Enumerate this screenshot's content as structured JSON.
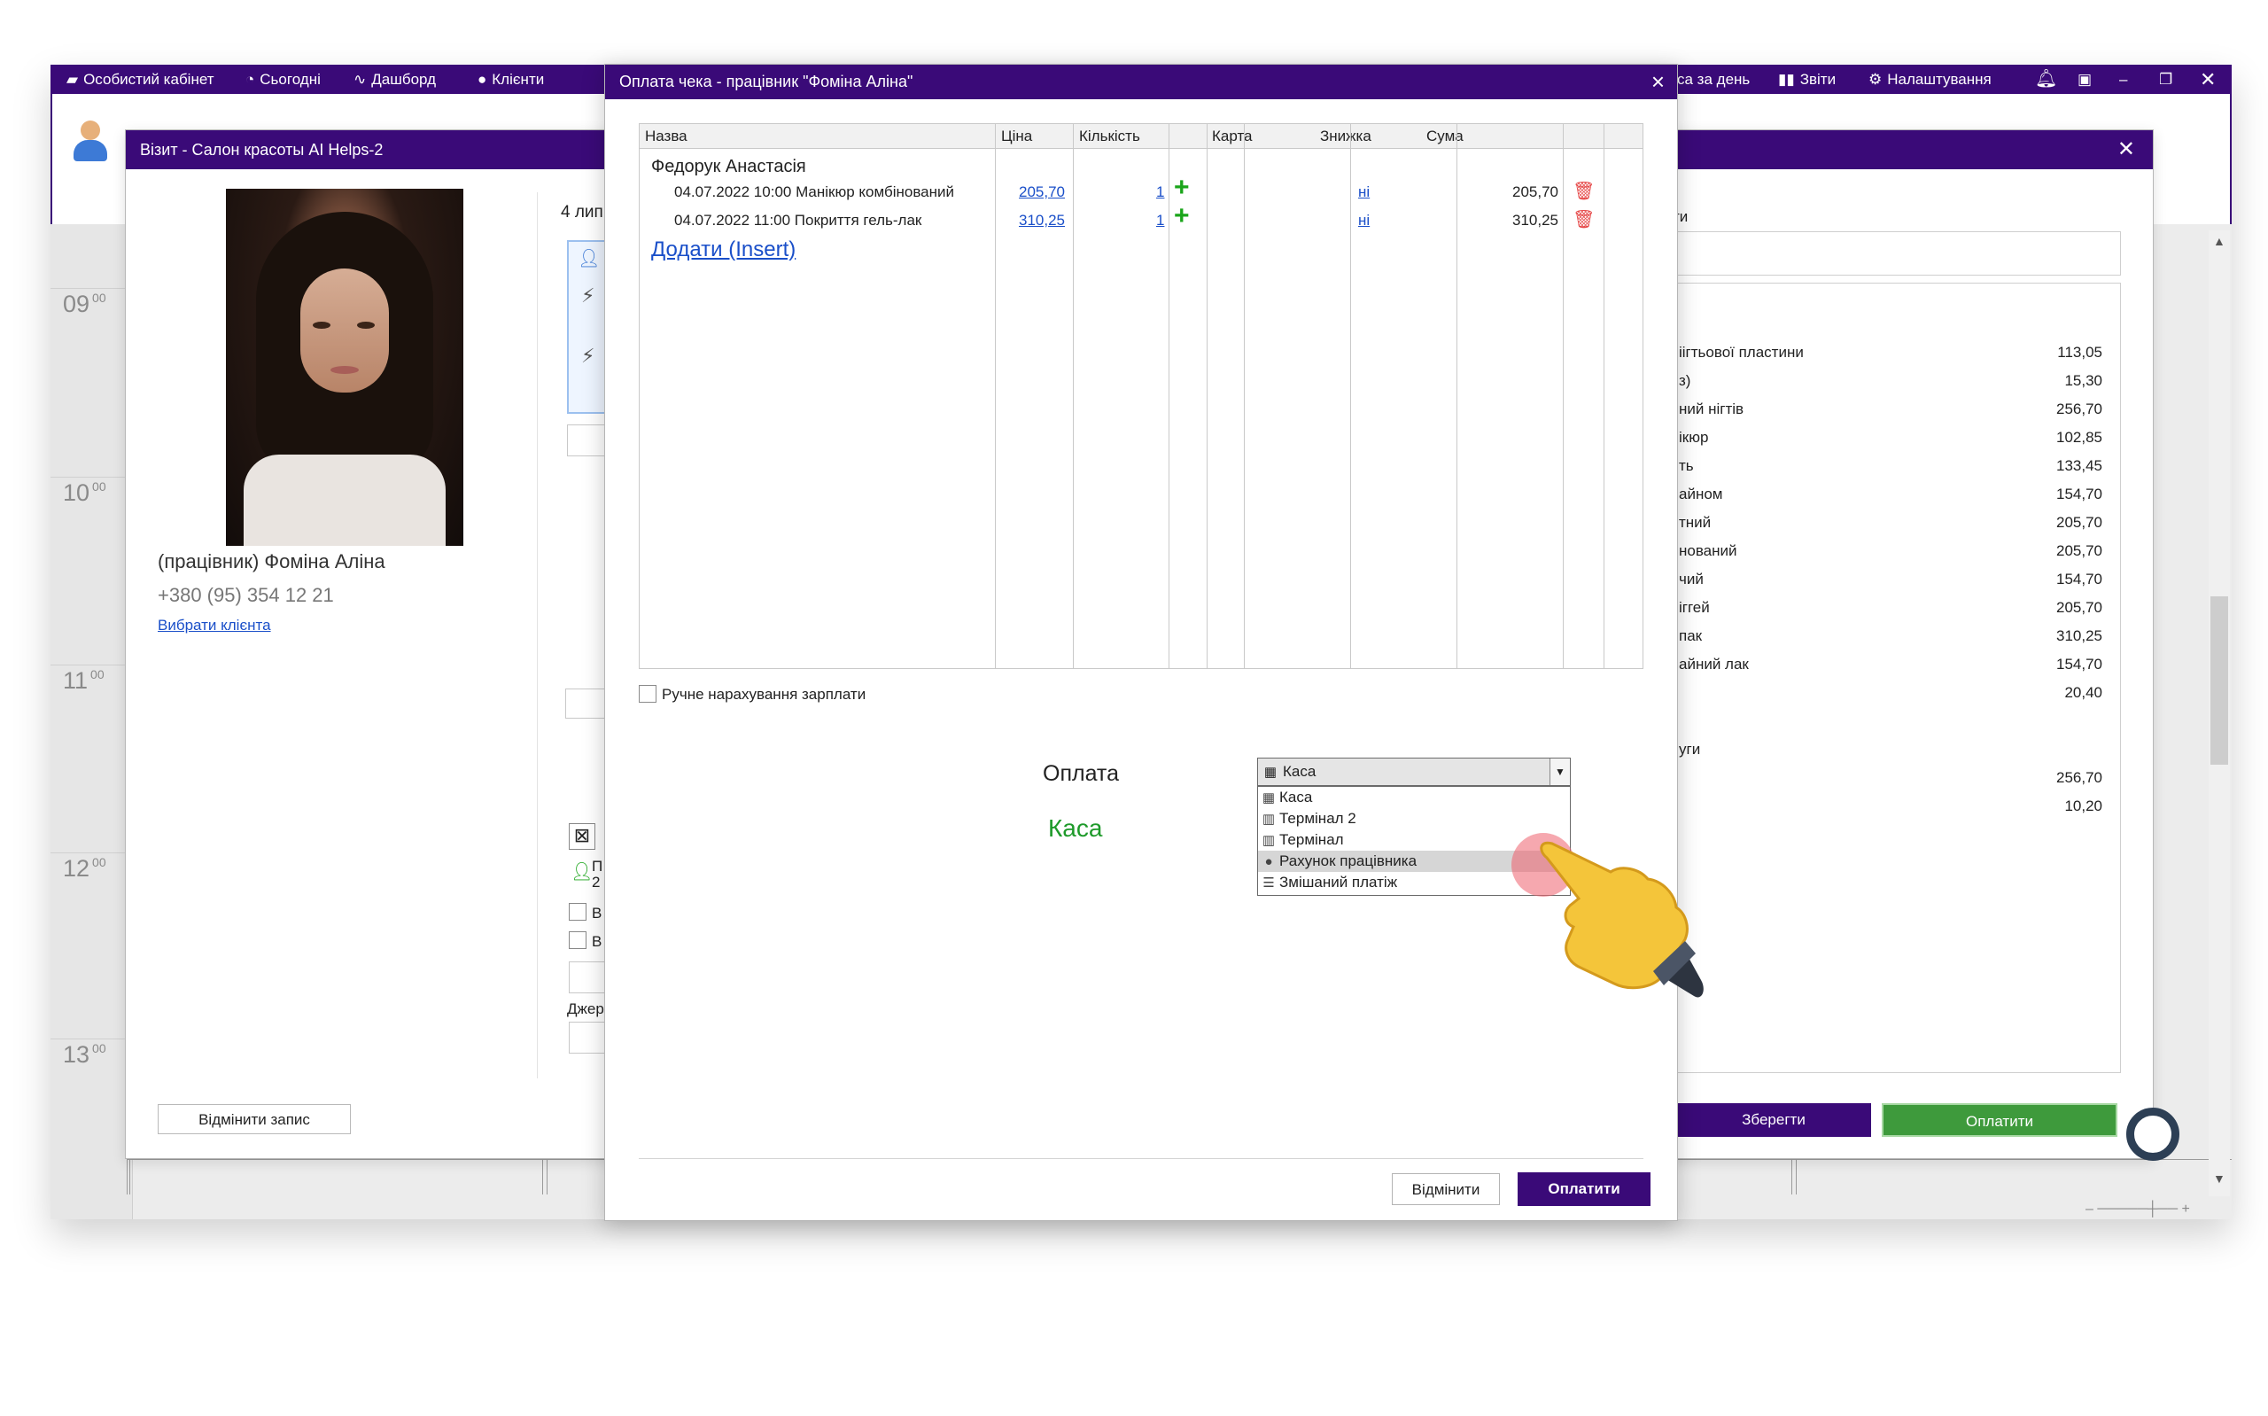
{
  "topbar": {
    "items": [
      {
        "label": "Особистий кабінет",
        "icon": "briefcase-icon"
      },
      {
        "label": "Сьогодні",
        "icon": "clock-icon"
      },
      {
        "label": "Дашборд",
        "icon": "pulse-icon"
      },
      {
        "label": "Клієнти",
        "icon": "user-icon"
      },
      {
        "label": "са за день",
        "icon": ""
      },
      {
        "label": "Звіти",
        "icon": "bar-chart-icon"
      },
      {
        "label": "Налаштування",
        "icon": "gear-icon"
      }
    ]
  },
  "calendar": {
    "hours": [
      {
        "h": "09",
        "m": "00"
      },
      {
        "h": "10",
        "m": "00"
      },
      {
        "h": "11",
        "m": "00"
      },
      {
        "h": "12",
        "m": "00"
      },
      {
        "h": "13",
        "m": "00"
      }
    ]
  },
  "visit": {
    "title": "Візит - Салон красоты AI Helps-2",
    "worker": "(працівник) Фоміна Аліна",
    "phone": "+380 (95) 354 12 21",
    "choose_client": "Вибрати клієнта",
    "date_partial": "4 лип",
    "cancel_record": "Відмінити запис",
    "middle_partial": {
      "l1": "П",
      "l2": "2",
      "l3": "В",
      "l4": "В",
      "l5": "Джер"
    },
    "right_heading": "ти",
    "services": [
      {
        "name": "іігтьової пластини",
        "price": "113,05"
      },
      {
        "name": "з)",
        "price": "15,30"
      },
      {
        "name": "ний нігтів",
        "price": "256,70"
      },
      {
        "name": "ікюр",
        "price": "102,85"
      },
      {
        "name": "ть",
        "price": "133,45"
      },
      {
        "name": "айном",
        "price": "154,70"
      },
      {
        "name": "тний",
        "price": "205,70"
      },
      {
        "name": "нований",
        "price": "205,70"
      },
      {
        "name": "чий",
        "price": "154,70"
      },
      {
        "name": "іггей",
        "price": "205,70"
      },
      {
        "name": "пак",
        "price": "310,25"
      },
      {
        "name": "айний лак",
        "price": "154,70"
      },
      {
        "name": "",
        "price": "20,40"
      },
      {
        "name": "",
        "price": ""
      },
      {
        "name": "уги",
        "price": ""
      },
      {
        "name": "",
        "price": "256,70"
      },
      {
        "name": "",
        "price": "10,20"
      }
    ],
    "save": "Зберегти",
    "pay": "Оплатити"
  },
  "payment": {
    "title": "Оплата чека - працівник \"Фоміна Аліна\"",
    "close": "×",
    "columns": [
      "Назва",
      "Ціна",
      "Кількість",
      "",
      "",
      "Карта",
      "Знижка",
      "Сума",
      ""
    ],
    "client": "Федорук Анастасія",
    "rows": [
      {
        "name": "04.07.2022 10:00 Манікюр комбінований",
        "price": "205,70",
        "qty": "1",
        "discount": "ні",
        "sum": "205,70"
      },
      {
        "name": "04.07.2022 11:00 Покриття гель-лак",
        "price": "310,25",
        "qty": "1",
        "discount": "ні",
        "sum": "310,25"
      }
    ],
    "add_link": "Додати (Insert)",
    "manual_salary": "Ручне нарахування зарплати",
    "payment_label": "Оплата",
    "payment_method_display": "Каса",
    "combo_value": "Каса",
    "options": [
      {
        "label": "Каса",
        "icon": "calculator-icon"
      },
      {
        "label": "Термінал 2",
        "icon": "terminal-icon"
      },
      {
        "label": "Термінал",
        "icon": "terminal-icon"
      },
      {
        "label": "Рахунок працівника",
        "icon": "person-icon",
        "highlighted": true
      },
      {
        "label": "Змішаний платіж",
        "icon": "list-icon"
      }
    ],
    "cancel": "Відмінити",
    "pay": "Оплатити"
  },
  "colors": {
    "brand_purple": "#3a0a78",
    "green": "#3e9a3c",
    "link_blue": "#1a4fc9"
  }
}
